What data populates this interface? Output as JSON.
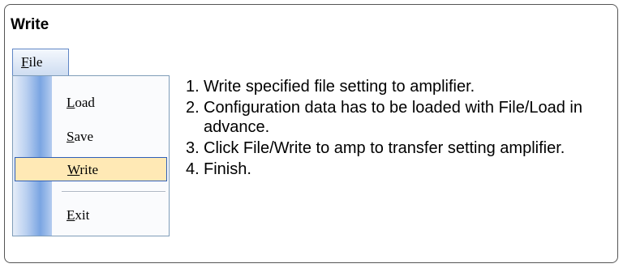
{
  "title": "Write",
  "menu": {
    "header": "File",
    "items": [
      {
        "label": "Load",
        "selected": false
      },
      {
        "label": "Save",
        "selected": false
      },
      {
        "label": "Write",
        "selected": true
      },
      {
        "label": "Exit",
        "selected": false
      }
    ],
    "colors": {
      "highlight": "#ffe9b5",
      "highlight_border": "#2f5fb8",
      "gutter": "#7aa5e2"
    }
  },
  "steps": [
    {
      "num": "1.",
      "text": "Write specified file setting to amplifier."
    },
    {
      "num": "2.",
      "text": "Configuration data has to be loaded with File/Load in advance."
    },
    {
      "num": "3.",
      "text": "Click File/Write to amp to transfer setting amplifier."
    },
    {
      "num": "4.",
      "text": "Finish."
    }
  ]
}
